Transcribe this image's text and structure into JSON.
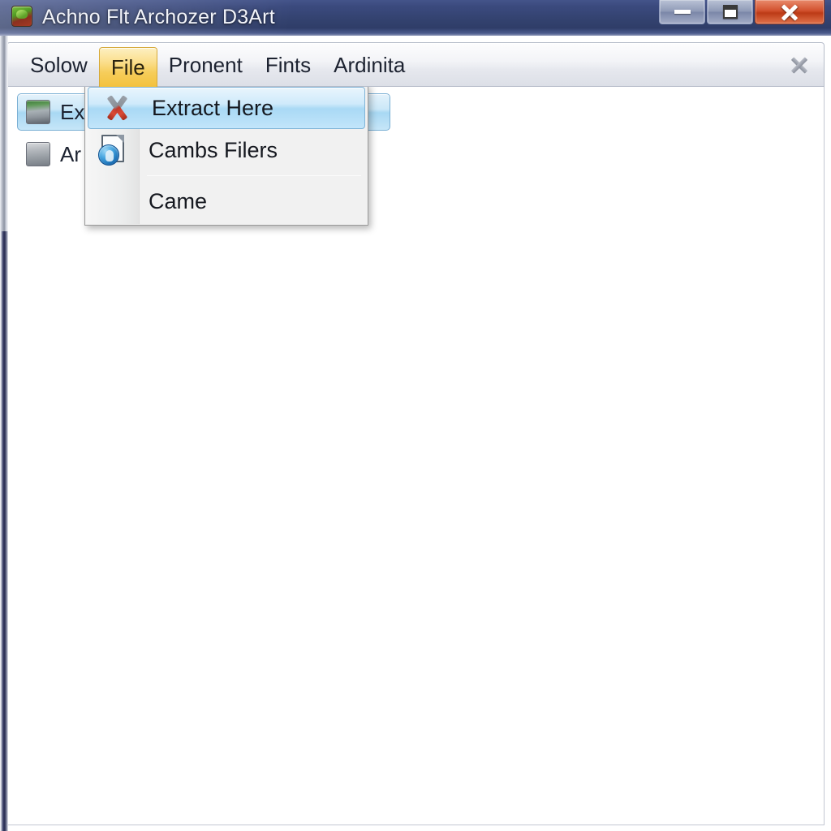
{
  "window": {
    "title": "Achno Flt Archozer D3Art",
    "app_icon": "archive-app-icon",
    "controls": {
      "minimize_label": "Minimize",
      "maximize_label": "Maximize",
      "close_label": "Close"
    }
  },
  "menubar": {
    "items": [
      {
        "label": "Solow",
        "active": false
      },
      {
        "label": "File",
        "active": true
      },
      {
        "label": "Pronent",
        "active": false
      },
      {
        "label": "Fints",
        "active": false
      },
      {
        "label": "Ardinita",
        "active": false
      }
    ],
    "close_label": "Close"
  },
  "toolbar": {
    "rows": [
      {
        "label": "Ex",
        "icon": "extract-archive-icon",
        "selected": true
      },
      {
        "label": "Ar",
        "icon": "add-archive-icon",
        "selected": false
      }
    ]
  },
  "dropdown": {
    "owner": "File",
    "items": [
      {
        "label": "Extract Here",
        "icon": "extract-x-icon",
        "highlighted": true,
        "separator_after": false
      },
      {
        "label": "Cambs Filers",
        "icon": "document-globe-icon",
        "highlighted": false,
        "separator_after": true
      },
      {
        "label": "Came",
        "icon": "",
        "highlighted": false,
        "separator_after": false
      }
    ]
  },
  "colors": {
    "titlebar": "#33426f",
    "menu_active": "#f6cd5a",
    "selection": "#a9d9f5",
    "close_button": "#bc3a16",
    "frame_edge": "#2c3055"
  }
}
